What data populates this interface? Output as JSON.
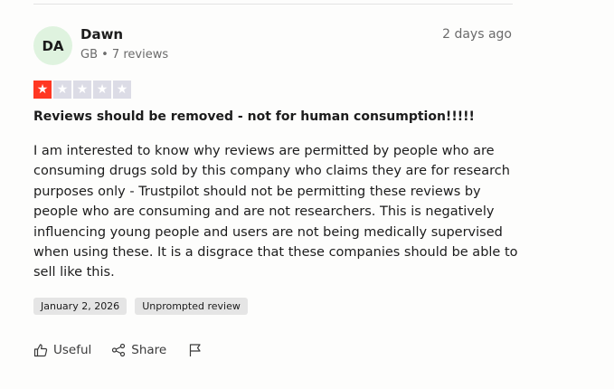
{
  "review": {
    "avatar_initials": "DA",
    "author": "Dawn",
    "meta": "GB • 7 reviews",
    "posted_ago": "2 days ago",
    "rating": 1,
    "rating_max": 5,
    "rating_color": "#ff3722",
    "title": "Reviews should be removed - not for human consumption!!!!!",
    "body": "I am interested to know why reviews are permitted by people who are consuming drugs sold by this company who claims they are for research purposes only - Trustpilot should not be permitting these reviews by people who are consuming and are not researchers. This is negatively influencing young people and users are not being medically supervised when using these. It is a disgrace that these companies should be able to sell like this.",
    "experience_date": "January 2, 2026",
    "review_type": "Unprompted review"
  },
  "actions": {
    "useful_label": "Useful",
    "share_label": "Share",
    "useful_icon": "thumbs-up-icon",
    "share_icon": "share-icon",
    "flag_icon": "flag-icon"
  }
}
